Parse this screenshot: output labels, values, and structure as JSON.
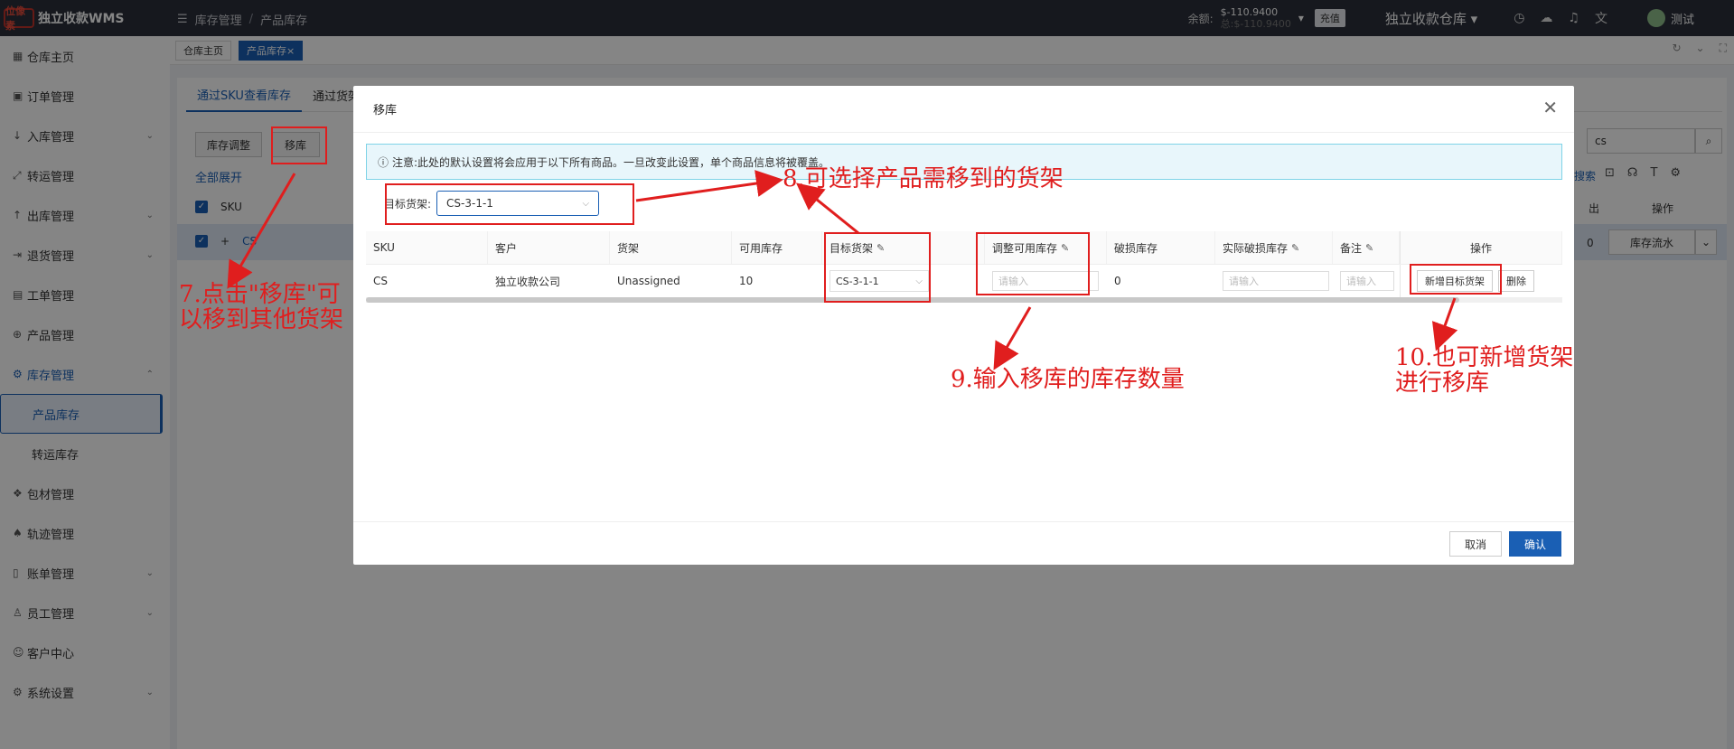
{
  "app": {
    "logo_text": "位像素",
    "title": "独立收款WMS"
  },
  "breadcrumb": {
    "first": "库存管理",
    "second": "产品库存"
  },
  "header": {
    "balance_label": "余额:",
    "balance_value": "$-110.9400",
    "balance_total": "总:$-110.9400",
    "recharge": "充值",
    "warehouse": "独立收款仓库",
    "user": "测试"
  },
  "sidebar": {
    "items": [
      {
        "label": "仓库主页",
        "icon": "home-icon"
      },
      {
        "label": "订单管理",
        "icon": "order-icon"
      },
      {
        "label": "入库管理",
        "icon": "inbound-icon",
        "expand": true
      },
      {
        "label": "转运管理",
        "icon": "transfer-icon"
      },
      {
        "label": "出库管理",
        "icon": "outbound-icon",
        "expand": true
      },
      {
        "label": "退货管理",
        "icon": "return-icon",
        "expand": true
      },
      {
        "label": "工单管理",
        "icon": "ticket-icon"
      },
      {
        "label": "产品管理",
        "icon": "product-icon"
      },
      {
        "label": "库存管理",
        "icon": "inventory-icon",
        "expand": true,
        "active": true
      }
    ],
    "sub_items": [
      "产品库存",
      "转运库存"
    ],
    "items2": [
      {
        "label": "包材管理",
        "icon": "package-icon"
      },
      {
        "label": "轨迹管理",
        "icon": "track-icon"
      },
      {
        "label": "账单管理",
        "icon": "bill-icon",
        "expand": true
      },
      {
        "label": "员工管理",
        "icon": "staff-icon",
        "expand": true
      },
      {
        "label": "客户中心",
        "icon": "customer-icon"
      },
      {
        "label": "系统设置",
        "icon": "settings-icon",
        "expand": true
      }
    ]
  },
  "page_tabs": {
    "home": "仓库主页",
    "current": "产品库存"
  },
  "subtabs": [
    "通过SKU查看库存",
    "通过货架"
  ],
  "toolbar": {
    "adjust": "库存调整",
    "move": "移库",
    "expand_all": "全部展开",
    "search_value": "cs",
    "search_link": "搜索"
  },
  "bg_table": {
    "sku_header": "SKU",
    "out_header": "出",
    "ops_header": "操作",
    "row_sku": "CS",
    "row_qty": "0",
    "row_action": "库存流水"
  },
  "modal": {
    "title": "移库",
    "notice": "注意:此处的默认设置将会应用于以下所有商品。一旦改变此设置，单个商品信息将被覆盖。",
    "target_label": "目标货架:",
    "target_value": "CS-3-1-1",
    "columns": [
      "SKU",
      "客户",
      "货架",
      "可用库存",
      "目标货架",
      "调整可用库存",
      "破损库存",
      "实际破损库存",
      "备注",
      "操作"
    ],
    "row": {
      "sku": "CS",
      "customer": "独立收款公司",
      "shelf": "Unassigned",
      "available": "10",
      "target_shelf": "CS-3-1-1",
      "adjust_placeholder": "请输入",
      "damaged": "0",
      "actual_damaged_placeholder": "请输入",
      "remark_placeholder": "请输入",
      "add_target": "新增目标货架",
      "delete": "删除"
    },
    "cancel": "取消",
    "confirm": "确认"
  },
  "annotations": {
    "a7_line1": "7.点击\"移库\"可",
    "a7_line2": "以移到其他货架",
    "a8": "8.可选择产品需移到的货架",
    "a9": "9.输入移库的库存数量",
    "a10_line1": "10.也可新增货架",
    "a10_line2": "进行移库"
  },
  "colors": {
    "accent": "#1a5fb4",
    "annotation": "#e01e1e",
    "topbar": "#2b2f3a"
  }
}
